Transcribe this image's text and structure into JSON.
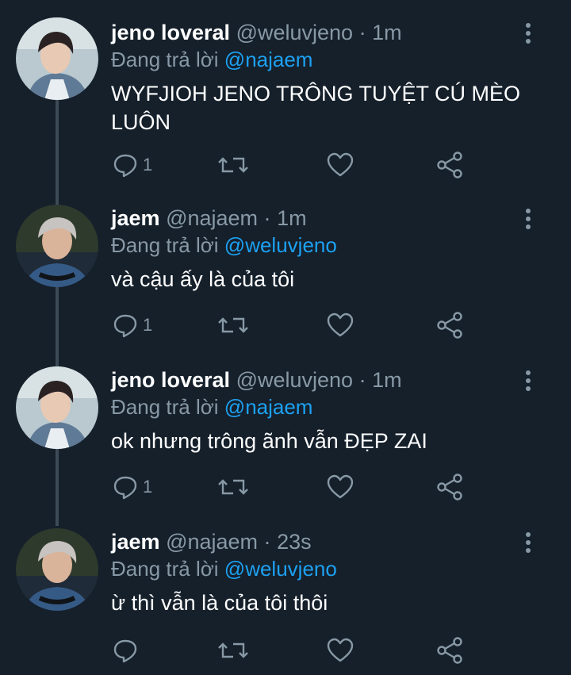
{
  "tweets": [
    {
      "name": "jeno loveral",
      "handle": "@weluvjeno",
      "dot": "·",
      "time": "1m",
      "replying_prefix": "Đang trả lời",
      "replying_to": "@najaem",
      "text": "WYFJIOH JENO TRÔNG TUYỆT CÚ MÈO LUÔN",
      "reply_count": "1"
    },
    {
      "name": "jaem",
      "handle": "@najaem",
      "dot": "·",
      "time": "1m",
      "replying_prefix": "Đang trả lời",
      "replying_to": "@weluvjeno",
      "text": "và cậu ấy là của tôi",
      "reply_count": "1"
    },
    {
      "name": "jeno loveral",
      "handle": "@weluvjeno",
      "dot": "·",
      "time": "1m",
      "replying_prefix": "Đang trả lời",
      "replying_to": "@najaem",
      "text": "ok nhưng trông ãnh vẫn ĐẸP ZAI",
      "reply_count": "1"
    },
    {
      "name": "jaem",
      "handle": "@najaem",
      "dot": "·",
      "time": "23s",
      "replying_prefix": "Đang trả lời",
      "replying_to": "@weluvjeno",
      "text": "ừ thì vẫn là của tôi thôi",
      "reply_count": ""
    }
  ],
  "colors": {
    "background": "#15202b",
    "secondary_text": "#8899a6",
    "mention": "#1da1f2",
    "thread_line": "#3d4a57"
  },
  "icons": [
    "reply-icon",
    "retweet-icon",
    "like-icon",
    "share-icon",
    "more-vertical-icon"
  ]
}
